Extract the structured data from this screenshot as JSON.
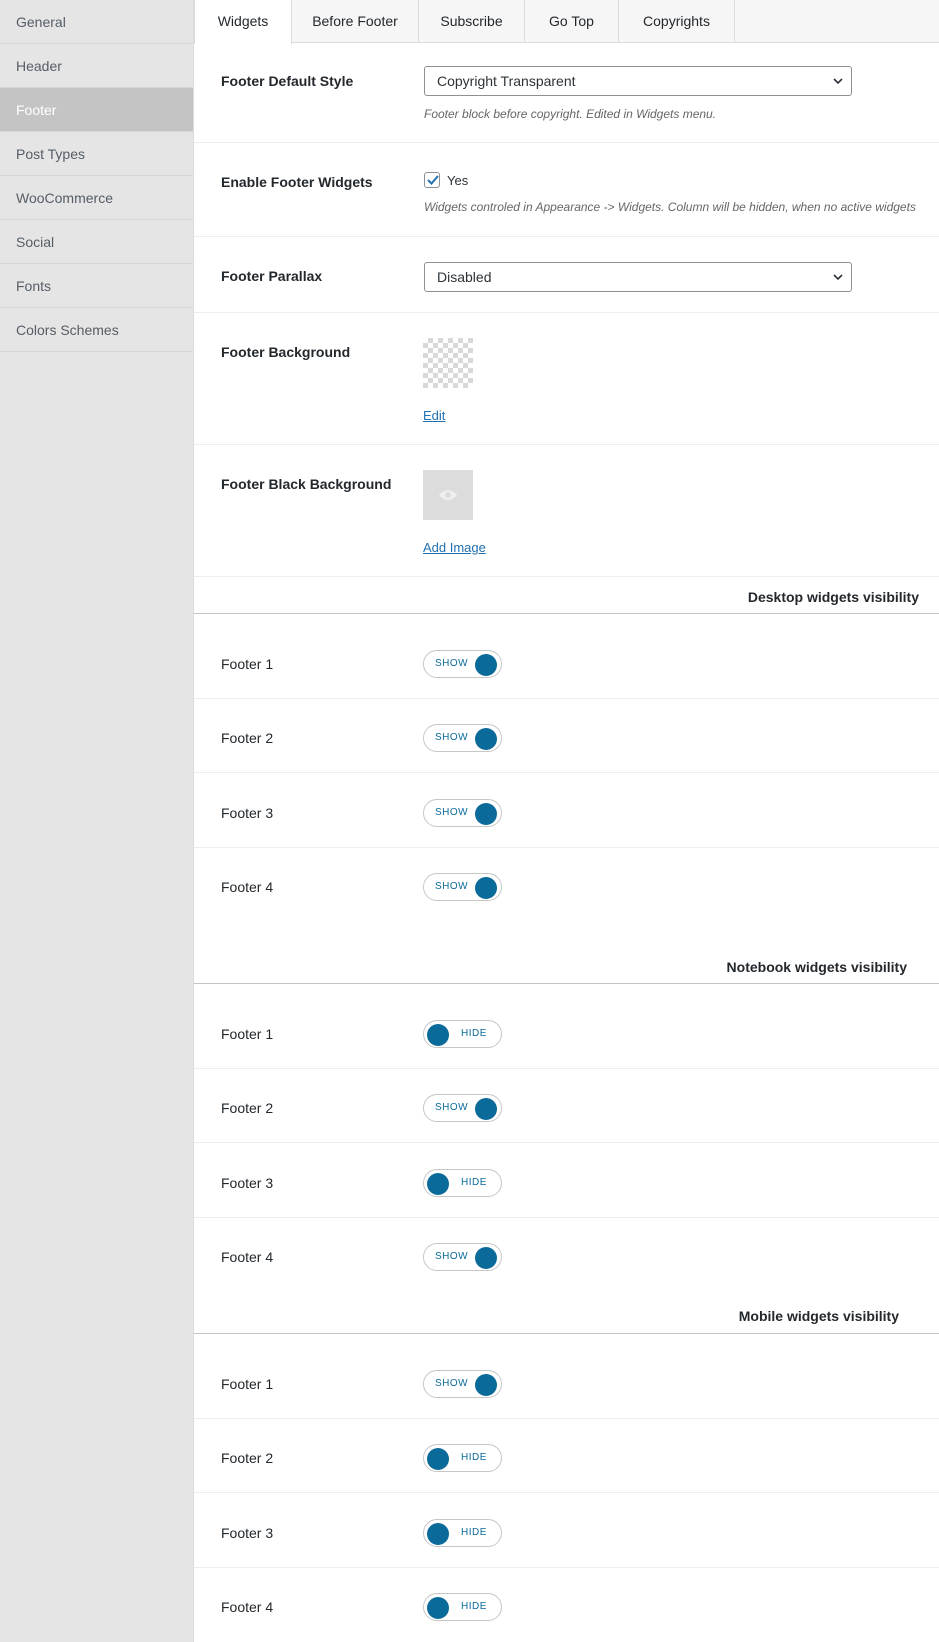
{
  "sidebar": {
    "items": [
      {
        "label": "General"
      },
      {
        "label": "Header"
      },
      {
        "label": "Footer"
      },
      {
        "label": "Post Types"
      },
      {
        "label": "WooCommerce"
      },
      {
        "label": "Social"
      },
      {
        "label": "Fonts"
      },
      {
        "label": "Colors Schemes"
      }
    ],
    "active": "Footer"
  },
  "tabs": [
    {
      "label": "Widgets"
    },
    {
      "label": "Before Footer"
    },
    {
      "label": "Subscribe"
    },
    {
      "label": "Go Top"
    },
    {
      "label": "Copyrights"
    }
  ],
  "settings": {
    "default_style": {
      "label": "Footer Default Style",
      "value": "Copyright Transparent",
      "desc": "Footer block before copyright. Edited in Widgets menu."
    },
    "enable_widgets": {
      "label": "Enable Footer Widgets",
      "check_label": "Yes",
      "desc": "Widgets controled in Appearance -> Widgets. Column will be hidden, when no active widgets"
    },
    "parallax": {
      "label": "Footer Parallax",
      "value": "Disabled"
    },
    "background": {
      "label": "Footer Background",
      "link": "Edit"
    },
    "black_background": {
      "label": "Footer Black Background",
      "link": "Add Image"
    }
  },
  "visibility": {
    "desktop": {
      "title": "Desktop widgets visibility",
      "items": [
        {
          "label": "Footer 1",
          "state": "SHOW"
        },
        {
          "label": "Footer 2",
          "state": "SHOW"
        },
        {
          "label": "Footer 3",
          "state": "SHOW"
        },
        {
          "label": "Footer 4",
          "state": "SHOW"
        }
      ]
    },
    "notebook": {
      "title": "Notebook widgets visibility",
      "items": [
        {
          "label": "Footer 1",
          "state": "HIDE"
        },
        {
          "label": "Footer 2",
          "state": "SHOW"
        },
        {
          "label": "Footer 3",
          "state": "HIDE"
        },
        {
          "label": "Footer 4",
          "state": "SHOW"
        }
      ]
    },
    "mobile": {
      "title": "Mobile widgets visibility",
      "items": [
        {
          "label": "Footer 1",
          "state": "SHOW"
        },
        {
          "label": "Footer 2",
          "state": "HIDE"
        },
        {
          "label": "Footer 3",
          "state": "HIDE"
        },
        {
          "label": "Footer 4",
          "state": "HIDE"
        }
      ]
    }
  },
  "colors": {
    "accent": "#0a6a9a",
    "link": "#2271b1",
    "sidebar_bg": "#e5e5e5",
    "sidebar_active": "#c4c4c4"
  }
}
